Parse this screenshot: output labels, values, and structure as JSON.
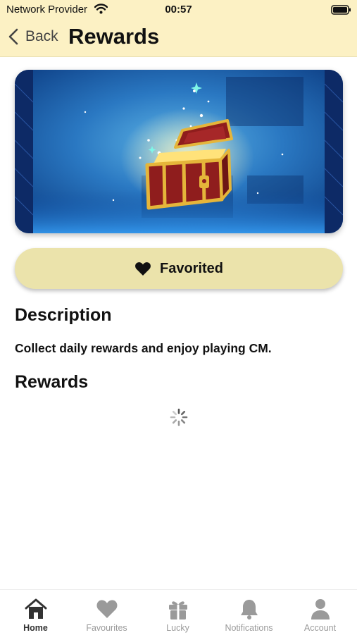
{
  "status_bar": {
    "carrier": "Network Provider",
    "time": "00:57",
    "icons": [
      "wifi-icon",
      "battery-icon"
    ]
  },
  "nav": {
    "back_label": "Back",
    "title": "Rewards",
    "back_icon": "chevron-left-icon"
  },
  "hero_image": {
    "subject": "treasure-chest",
    "colors": {
      "background": "#0d4fa3",
      "glow": "#4fc3ff",
      "chest": "#8f1d1d",
      "trim": "#e5b53a"
    }
  },
  "favorite_button": {
    "label": "Favorited",
    "icon": "heart-icon",
    "state": "favorited",
    "background": "#ebe3ab"
  },
  "description": {
    "heading": "Description",
    "text": "Collect daily rewards and enjoy playing CM."
  },
  "rewards": {
    "heading": "Rewards",
    "loading": true
  },
  "tab_bar": {
    "active_index": 0,
    "tabs": [
      {
        "label": "Home",
        "icon": "home-icon"
      },
      {
        "label": "Favourites",
        "icon": "heart-icon"
      },
      {
        "label": "Lucky",
        "icon": "gift-icon"
      },
      {
        "label": "Notifications",
        "icon": "bell-icon"
      },
      {
        "label": "Account",
        "icon": "person-icon"
      }
    ]
  },
  "theme": {
    "header_background": "#fcf1c4",
    "active_tab": "#333333",
    "inactive_tab": "#9a9a9a"
  }
}
